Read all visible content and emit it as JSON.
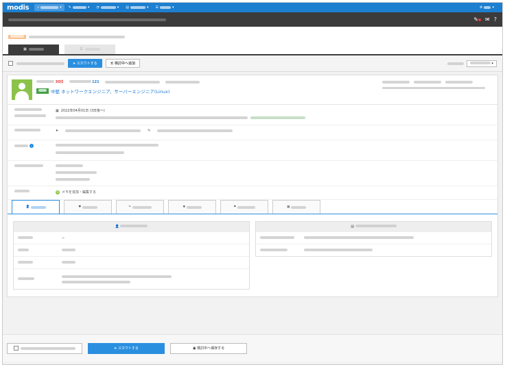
{
  "nav": {
    "logo": "modis",
    "items": [
      {
        "label": "▾",
        "icon": "search-icon"
      },
      {
        "label": "▾",
        "icon": "pencil-icon"
      },
      {
        "label": "▾",
        "icon": "chart-icon"
      },
      {
        "label": "▾",
        "icon": "doc-icon"
      },
      {
        "label": "▾",
        "icon": "menu-icon"
      }
    ],
    "right": "▾"
  },
  "toolbar": {
    "scout_button": "スカウトする",
    "review_button": "検討中へ追加"
  },
  "profile": {
    "last_login_value": "30日",
    "scout_count_value": "121",
    "title": "中堅 ネットワークエンジニア、サーバーエンジニア(Linux)"
  },
  "rows": {
    "date_value": "2022年04月01日 (3日後〜)",
    "memo_add": "メモを追加・編集する"
  },
  "footer": {
    "scout_button": "スカウトする",
    "review_button": "検討中へ保存する"
  },
  "colors": {
    "nav": "#1c7fd0",
    "subbar": "#3b3b3b",
    "primary": "#2b8fe0",
    "avatar": "#8bc34a",
    "badge": "#43a047",
    "alert": "#e53935"
  }
}
